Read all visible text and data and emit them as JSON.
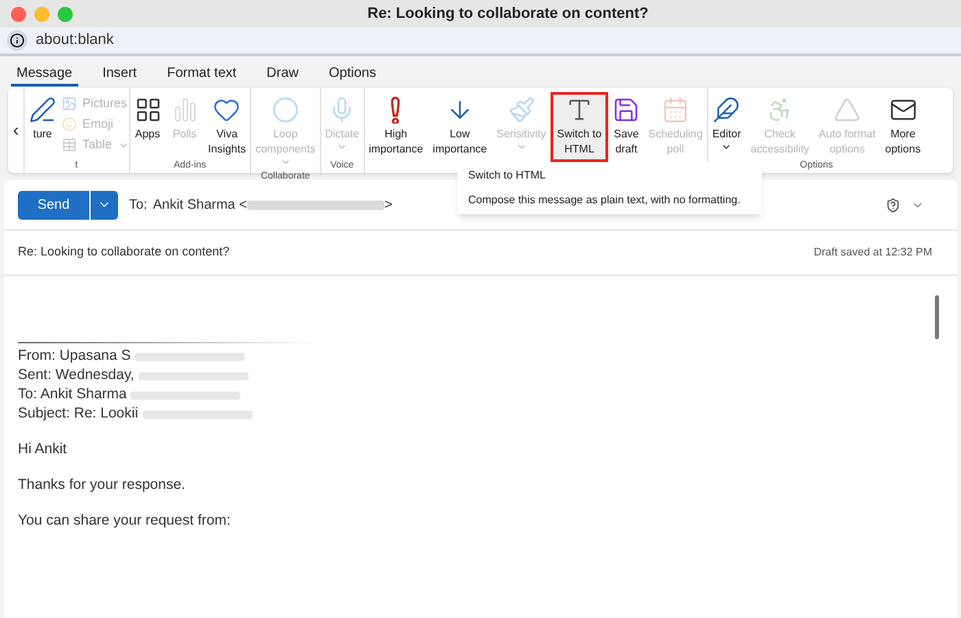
{
  "window": {
    "title": "Re: Looking to collaborate on content?"
  },
  "address_bar": {
    "url": "about:blank"
  },
  "tabs": [
    {
      "label": "Message",
      "selected": true
    },
    {
      "label": "Insert",
      "selected": false
    },
    {
      "label": "Format text",
      "selected": false
    },
    {
      "label": "Draw",
      "selected": false
    },
    {
      "label": "Options",
      "selected": false
    }
  ],
  "ribbon": {
    "groups": [
      {
        "label": "t",
        "items": [
          {
            "kind": "large",
            "label": "ture",
            "disabled": false,
            "dropdown": false,
            "highlighted": false
          },
          {
            "kind": "small",
            "label": "Pictures",
            "disabled": true,
            "dropdown": false
          },
          {
            "kind": "small",
            "label": "Emoji",
            "disabled": true,
            "dropdown": false
          },
          {
            "kind": "small",
            "label": "Table",
            "disabled": true,
            "dropdown": true
          }
        ]
      },
      {
        "label": "Add-ins",
        "items": [
          {
            "kind": "large",
            "label": "Apps",
            "disabled": false,
            "dropdown": false,
            "highlighted": false
          },
          {
            "kind": "large",
            "label": "Polls",
            "disabled": true,
            "dropdown": false,
            "highlighted": false
          },
          {
            "kind": "large",
            "label": "Viva\nInsights",
            "disabled": false,
            "dropdown": false,
            "highlighted": false
          }
        ]
      },
      {
        "label": "Collaborate",
        "items": [
          {
            "kind": "large",
            "label": "Loop\ncomponents",
            "disabled": true,
            "dropdown": true,
            "highlighted": false
          }
        ]
      },
      {
        "label": "Voice",
        "items": [
          {
            "kind": "large",
            "label": "Dictate",
            "disabled": true,
            "dropdown": true,
            "highlighted": false
          }
        ]
      },
      {
        "items": [
          {
            "kind": "large",
            "label": "High\nimportance",
            "disabled": false,
            "dropdown": false,
            "highlighted": false
          },
          {
            "kind": "large",
            "label": "Low\nimportance",
            "disabled": false,
            "dropdown": false,
            "highlighted": false
          },
          {
            "kind": "large",
            "label": "Sensitivity",
            "disabled": true,
            "dropdown": true,
            "highlighted": false
          }
        ]
      },
      {
        "items": [
          {
            "kind": "large",
            "label": "Switch to\nHTML",
            "disabled": false,
            "dropdown": false,
            "highlighted": true
          }
        ]
      },
      {
        "items": [
          {
            "kind": "large",
            "label": "Save\ndraft",
            "disabled": false,
            "dropdown": false,
            "highlighted": false
          }
        ]
      },
      {
        "items": [
          {
            "kind": "large",
            "label": "Scheduling\npoll",
            "disabled": true,
            "dropdown": false,
            "highlighted": false
          }
        ]
      },
      {
        "label": "Options",
        "items": [
          {
            "kind": "large",
            "label": "Editor",
            "disabled": false,
            "dropdown": true,
            "highlighted": false
          },
          {
            "kind": "large",
            "label": "Check\naccessibility",
            "disabled": true,
            "dropdown": false,
            "highlighted": false
          },
          {
            "kind": "large",
            "label": "Auto format\noptions",
            "disabled": true,
            "dropdown": false,
            "highlighted": false
          },
          {
            "kind": "large",
            "label": "More\noptions",
            "disabled": false,
            "dropdown": false,
            "highlighted": false
          }
        ]
      }
    ]
  },
  "tooltip": {
    "title": "Switch to HTML",
    "description": "Compose this message as plain text, with no formatting."
  },
  "compose": {
    "send_label": "Send",
    "to_label": "To:",
    "recipient": "Ankit Sharma <",
    "recipient_end": ">",
    "subject": "Re: Looking to collaborate on content?",
    "draft_status": "Draft saved at 12:32 PM",
    "body": [
      {
        "kind": "rule"
      },
      {
        "kind": "redacted_line",
        "text": "From: Upasana S"
      },
      {
        "kind": "redacted_line",
        "text": "Sent: Wednesday,"
      },
      {
        "kind": "redacted_line",
        "text": "To: Ankit Sharma"
      },
      {
        "kind": "redacted_line",
        "text": "Subject: Re: Lookii"
      },
      {
        "kind": "gap"
      },
      {
        "kind": "line",
        "text": "Hi Ankit"
      },
      {
        "kind": "gap"
      },
      {
        "kind": "line",
        "text": "Thanks for your response."
      },
      {
        "kind": "gap"
      },
      {
        "kind": "line",
        "text": "You can share your request from:"
      }
    ]
  }
}
